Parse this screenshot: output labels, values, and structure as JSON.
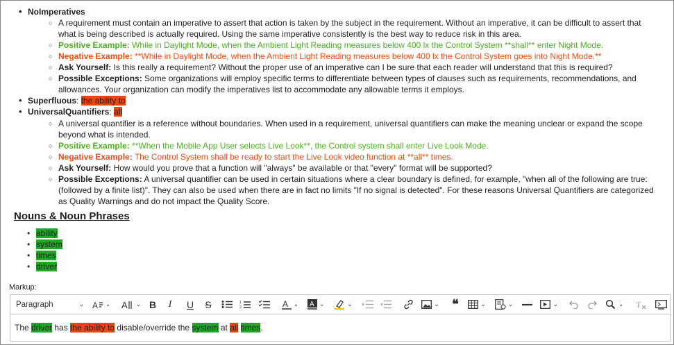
{
  "noimperatives": {
    "title": "NoImperatives",
    "desc": "A requirement must contain an imperative to assert that action is taken by the subject in the requirement. Without an imperative, it can be difficult to assert that what is being described is actually required. Using the same imperative consistently is the best way to reduce risk in this area.",
    "pos_label": "Positive Example:",
    "pos_text": "While in Daylight Mode, when the Ambient Light Reading measures below 400 lx the Control System **shall** enter Night Mode.",
    "neg_label": "Negative Example:",
    "neg_text": "**While in Daylight Mode, when the Ambient Light Reading measures below 400 lx the Control System goes into Night Mode.**",
    "ask_label": "Ask Yourself:",
    "ask_text": "Is this really a requirement? Without the proper use of an imperative can I be sure that each reader will understand that this is required?",
    "exc_label": "Possible Exceptions:",
    "exc_text": "Some organizations will employ specific terms to differentiate between types of clauses such as requirements, recommendations, and allowances. Your organization can modify the imperatives list to accommodate any allowable terms it employs."
  },
  "superfluous": {
    "title": "Superfluous",
    "sep": ": ",
    "term": "the ability to"
  },
  "universal": {
    "title": "UniversalQuantifiers",
    "sep": ": ",
    "term": "all",
    "desc": "A universal quantifier is a reference without boundaries. When used in a requirement, universal quantifiers can make the meaning unclear or expand the scope beyond what is intended.",
    "pos_label": "Positive Example:",
    "pos_text": "**When the Mobile App User selects Live Look**, the Control system shall enter Live Look Mode.",
    "neg_label": "Negative Example:",
    "neg_text": "The Control System shall be ready to start the Live Look video function at **all** times.",
    "ask_label": "Ask Yourself:",
    "ask_text": "How would you prove that a function will \"always\" be available or that \"every\" format will be supported?",
    "exc_label": "Possible Exceptions:",
    "exc_text": "A universal quantifier can be used in certain situations where a clear boundary is defined, for example, \"when all of the following are true: (followed by a finite list)\". They can also be used when there are in fact no limits \"If no signal is detected\". For these reasons Universal Quantifiers are categorized as Quality Warnings and do not impact the Quality Score."
  },
  "nouns": {
    "title": "Nouns & Noun Phrases",
    "items": [
      "ability",
      "system",
      "times",
      "driver"
    ]
  },
  "markup_label": "Markup:",
  "toolbar": {
    "paragraph": "Paragraph",
    "chevron": "⌄",
    "bold": "B",
    "italic": "I",
    "underline": "U",
    "strikethrough": "S",
    "quote": "❝"
  },
  "editor": {
    "t1": "The ",
    "w1": "driver",
    "t2": " has ",
    "w2": "the ability to",
    "t3": " disable/override the ",
    "w3": "system",
    "t4": " at ",
    "w4": "all",
    "t5": " ",
    "w5": "times",
    "t6": "."
  },
  "colors": {
    "green_text": "#4caf1e",
    "red_text": "#f24a0c",
    "hl_red": "#ee4411",
    "hl_green": "#1fa823"
  }
}
